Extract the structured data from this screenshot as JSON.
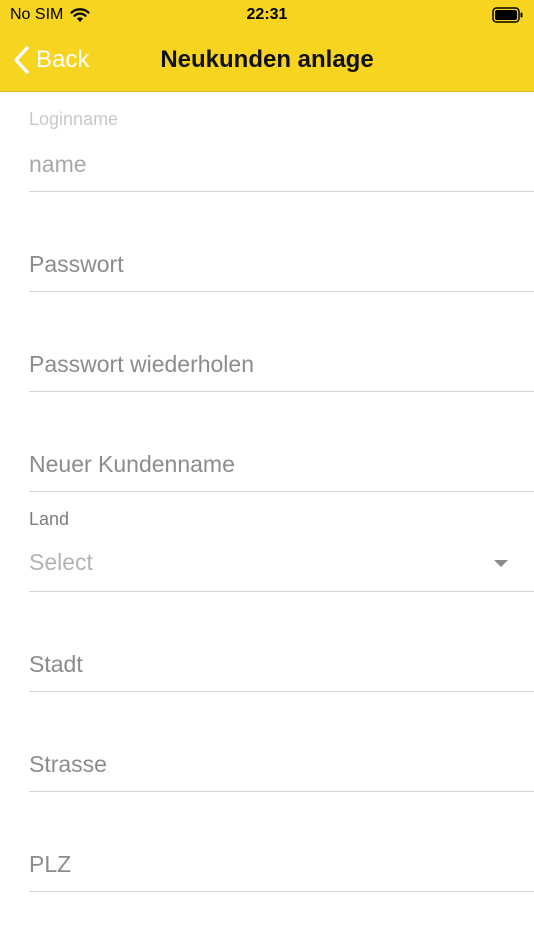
{
  "status_bar": {
    "carrier": "No SIM",
    "time": "22:31"
  },
  "navbar": {
    "back_label": "Back",
    "title": "Neukunden anlage",
    "background_color": "#f7d41f"
  },
  "form": {
    "login": {
      "label": "Loginname",
      "placeholder": "name"
    },
    "password": {
      "placeholder": "Passwort"
    },
    "password_repeat": {
      "placeholder": "Passwort wiederholen"
    },
    "customer_name": {
      "placeholder": "Neuer Kundenname"
    },
    "country": {
      "label": "Land",
      "value": "Select"
    },
    "city": {
      "placeholder": "Stadt"
    },
    "street": {
      "placeholder": "Strasse"
    },
    "zip": {
      "placeholder": "PLZ"
    }
  }
}
